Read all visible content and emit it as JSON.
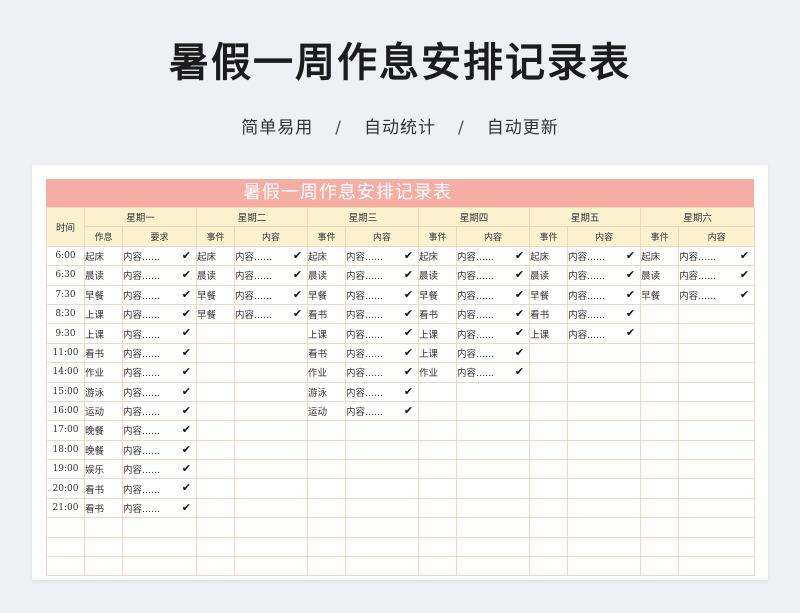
{
  "title": "暑假一周作息安排记录表",
  "subtitle": {
    "items": [
      "简单易用",
      "自动统计",
      "自动更新"
    ],
    "separator": "/"
  },
  "sheet": {
    "banner": "暑假一周作息安排记录表",
    "time_header": "时间",
    "days": [
      {
        "name": "星期一",
        "ev_label": "作息",
        "req_label": "要求"
      },
      {
        "name": "星期二",
        "ev_label": "事件",
        "req_label": "内容"
      },
      {
        "name": "星期三",
        "ev_label": "事件",
        "req_label": "内容"
      },
      {
        "name": "星期四",
        "ev_label": "事件",
        "req_label": "内容"
      },
      {
        "name": "星期五",
        "ev_label": "事件",
        "req_label": "内容"
      },
      {
        "name": "星期六",
        "ev_label": "事件",
        "req_label": "内容"
      }
    ],
    "content_text": "内容......",
    "check_mark": "✔",
    "times": [
      "6:00",
      "6:30",
      "7:30",
      "8:30",
      "9:30",
      "11:00",
      "14:00",
      "15:00",
      "16:00",
      "17:00",
      "18:00",
      "19:00",
      "20:00",
      "21:00"
    ],
    "schedule": [
      [
        "起床",
        "晨读",
        "早餐",
        "上课",
        "上课",
        "看书",
        "作业",
        "游泳",
        "运动",
        "晚餐",
        "晚餐",
        "娱乐",
        "看书",
        "看书"
      ],
      [
        "起床",
        "晨读",
        "早餐",
        "早餐"
      ],
      [
        "起床",
        "晨读",
        "早餐",
        "看书",
        "上课",
        "看书",
        "作业",
        "游泳",
        "运动"
      ],
      [
        "起床",
        "晨读",
        "早餐",
        "看书",
        "上课",
        "上课",
        "作业"
      ],
      [
        "起床",
        "晨读",
        "早餐",
        "看书",
        "上课"
      ],
      [
        "起床",
        "晨读",
        "早餐"
      ]
    ],
    "blank_rows": 3
  }
}
